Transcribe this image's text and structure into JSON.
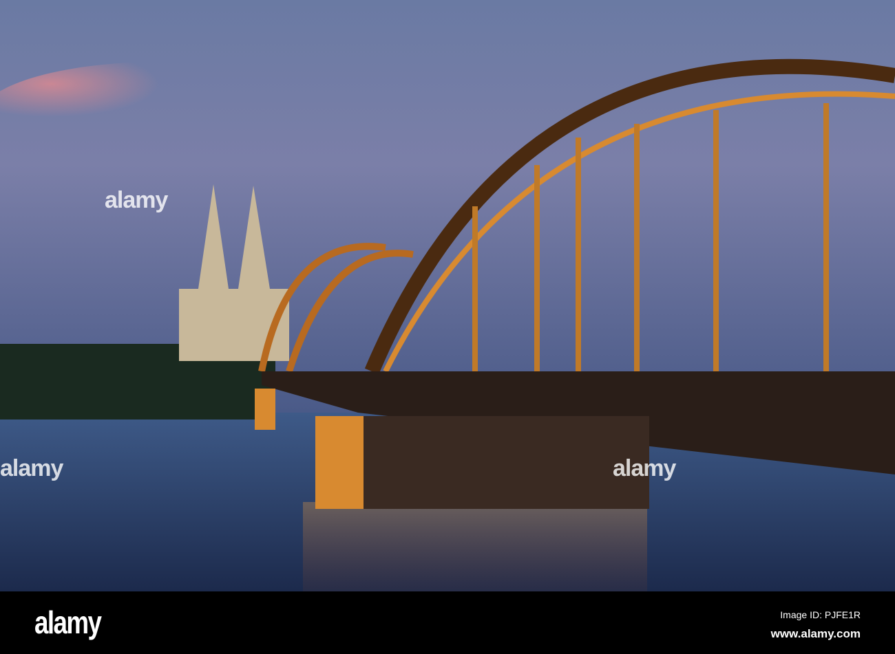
{
  "footer": {
    "logo": "alamy",
    "image_id": "Image ID: PJFE1R",
    "website": "www.alamy.com"
  },
  "watermark": "alamy",
  "colors": {
    "sky_top": "#6f7fa6",
    "sky_pink": "#c98a9a",
    "sky_bottom": "#4f5f8a",
    "water": "#2a3f6a",
    "bridge_light": "#e89a3a",
    "bridge_dark": "#3a2410"
  }
}
